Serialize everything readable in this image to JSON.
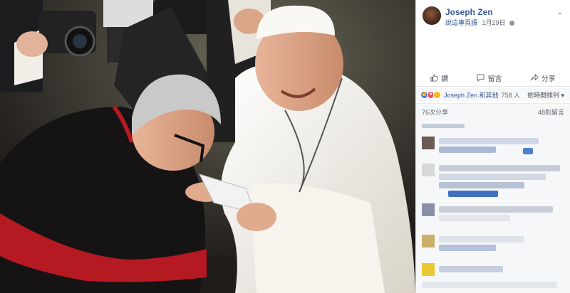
{
  "post": {
    "author": "Joseph Zen",
    "see_translation": "說這專頁讀",
    "date": "1月29日",
    "more_icon": "chevron-down-icon",
    "privacy_icon": "globe-icon"
  },
  "actions": {
    "like": "讚",
    "comment": "留言",
    "share": "分享"
  },
  "reactions": {
    "who": "Joseph Zen 和其他",
    "count": "758 人",
    "sort": "依時間排列 ▾"
  },
  "stats": {
    "shares": "76次分享",
    "comments": "48則留言"
  },
  "colors": {
    "link": "#365899",
    "panel_bg": "#f6f7f9",
    "cassock_red": "#c0171e",
    "papal_white": "#f4f1ea"
  },
  "photo_alt": "Cardinal bowing and kissing the hand of a smiling Pope in white while photographers take pictures"
}
